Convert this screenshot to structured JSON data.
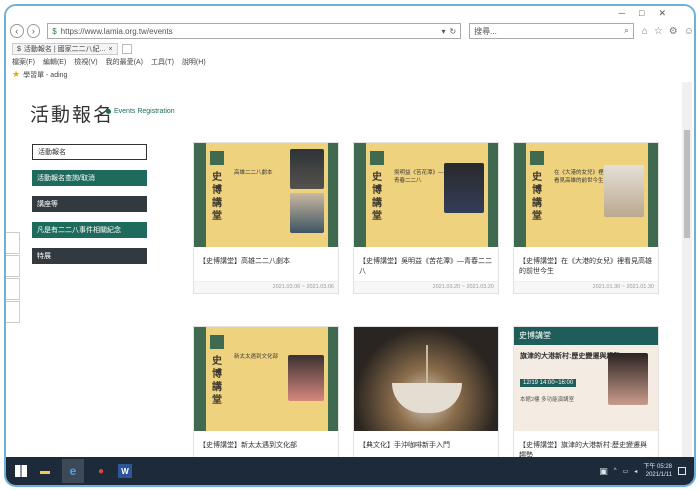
{
  "browser": {
    "url": "https://www.lamia.org.tw/events",
    "search_placeholder": "搜尋...",
    "tab_title": "活動報名 | 國家二二八紀...",
    "menu": [
      "檔案(F)",
      "編輯(E)",
      "檢視(V)",
      "我的最愛(A)",
      "工具(T)",
      "說明(H)"
    ],
    "favorites_label": "學習單 - ading",
    "win_controls": [
      "─",
      "□",
      "✕"
    ]
  },
  "page": {
    "title": "活動報名",
    "breadcrumb": "Events Registration"
  },
  "sidebar": {
    "items": [
      {
        "label": "活動報名",
        "style": "active"
      },
      {
        "label": "活動報名查詢/取消",
        "style": "teal"
      },
      {
        "label": "講座等",
        "style": "dark"
      },
      {
        "label": "凡是有二二八事件相關紀念",
        "style": "teal"
      },
      {
        "label": "特展",
        "style": "dark"
      }
    ]
  },
  "cards": [
    {
      "title": "【史博講堂】高雄二二八劇本",
      "date": "2021.03.06 ~ 2021.03.06",
      "poster_text": "高雄二二八劇本",
      "vertical_title": "史博講堂"
    },
    {
      "title": "【史博講堂】吳明益《苦花潭》—青春二二八",
      "date": "2021.03.20 ~ 2021.03.20",
      "poster_text": "吳明益《苦花潭》—青春二二八",
      "vertical_title": "史博講堂"
    },
    {
      "title": "【史博講堂】在《大港的女兒》裡看見高雄的前世今生",
      "date": "2021.01.30 ~ 2021.01.30",
      "poster_text": "在《大港的女兒》裡看見高雄的前世今生",
      "vertical_title": "史博講堂"
    },
    {
      "title": "【史博講堂】新太太遇到文化部",
      "date": "",
      "poster_text": "新太太遇到文化部",
      "vertical_title": "史博講堂"
    },
    {
      "title": "【典文化】手沖咖啡新手入門",
      "date": "",
      "poster_text": "",
      "vertical_title": ""
    },
    {
      "title": "【史博講堂】旗津的大港新村:歷史變遷與趨勢",
      "date": "",
      "poster_text": "旗津的大港新村:歷史變遷與趨勢",
      "vertical_title": "史博講堂",
      "promo_date": "12/19 14:00~16:00",
      "promo_location": "本館2樓 多功能演講室"
    }
  ],
  "taskbar": {
    "time": "下午 05:28",
    "date": "2021/1/11"
  },
  "colors": {
    "teal": "#1e6b5e",
    "dark": "#333a3f",
    "poster_yellow": "#efd27e",
    "poster_green": "#3f6a50",
    "taskbar": "#1c2a3a"
  }
}
